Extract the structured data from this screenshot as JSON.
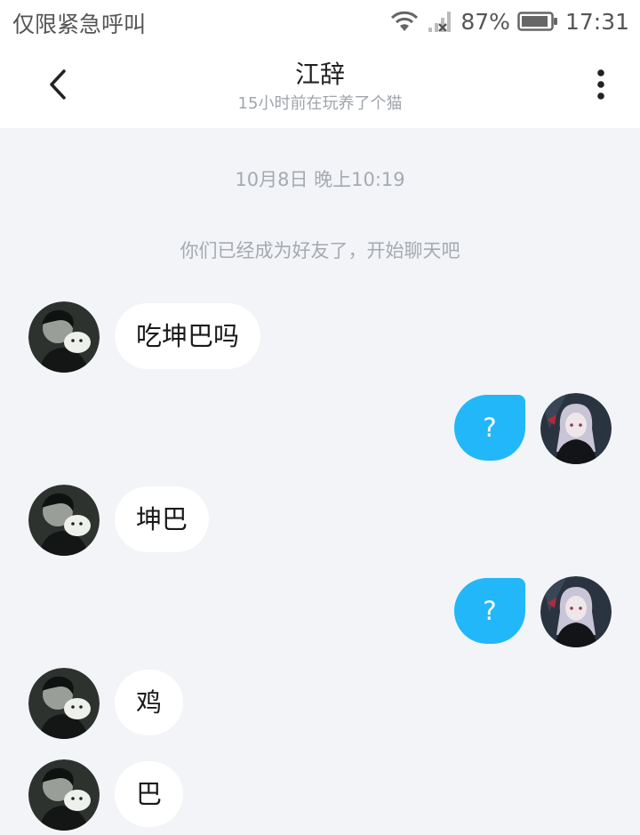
{
  "status_bar": {
    "carrier_text": "仅限紧急呼叫",
    "battery": "87%",
    "time": "17:31",
    "icons": [
      "wifi-icon",
      "signal-icon",
      "battery-icon"
    ]
  },
  "header": {
    "title": "江辞",
    "subtitle": "15小时前在玩养了个猫",
    "back_icon": "chevron-left-icon",
    "menu_icon": "more-vertical-icon"
  },
  "chat": {
    "timestamp": "10月8日 晚上10:19",
    "system_message": "你们已经成为好友了，开始聊天吧",
    "messages": [
      {
        "side": "left",
        "text": "吃坤巴吗"
      },
      {
        "side": "right",
        "text": "?"
      },
      {
        "side": "left",
        "text": "坤巴"
      },
      {
        "side": "right",
        "text": "?"
      },
      {
        "side": "left",
        "text": "鸡"
      },
      {
        "side": "left",
        "text": "巴"
      }
    ]
  },
  "colors": {
    "background": "#f2f4f7",
    "outgoing_bubble": "#22b7f8",
    "incoming_bubble": "#ffffff"
  }
}
